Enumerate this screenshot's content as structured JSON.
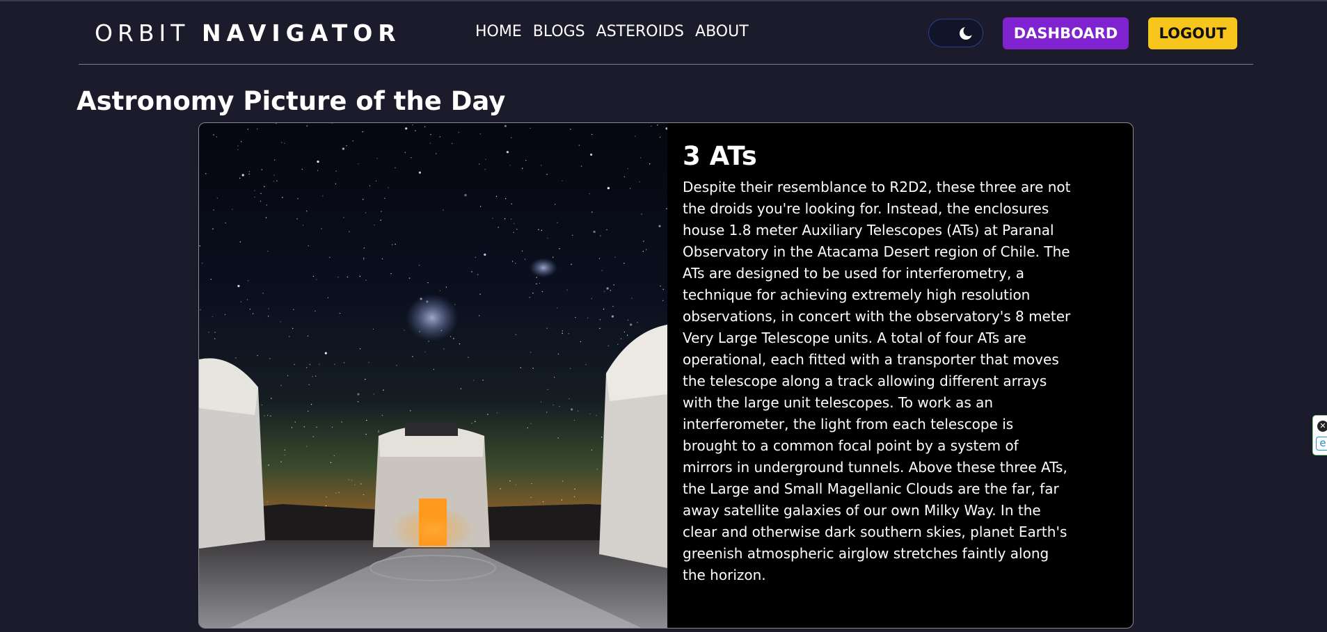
{
  "brand": {
    "light": "ORBIT",
    "bold": "NAVIGATOR"
  },
  "nav": {
    "links": [
      "HOME",
      "BLOGS",
      "ASTEROIDS",
      "ABOUT"
    ],
    "theme_toggle_icon": "moon-icon",
    "dashboard_label": "DASHBOARD",
    "logout_label": "LOGOUT"
  },
  "page": {
    "title": "Astronomy Picture of the Day"
  },
  "apod": {
    "title": "3 ATs",
    "description": "Despite their resemblance to R2D2, these three are not the droids you're looking for. Instead, the enclosures house 1.8 meter Auxiliary Telescopes (ATs) at Paranal Observatory in the Atacama Desert region of Chile. The ATs are designed to be used for interferometry, a technique for achieving extremely high resolution observations, in concert with the observatory's 8 meter Very Large Telescope units. A total of four ATs are operational, each fitted with a transporter that moves the telescope along a track allowing different arrays with the large unit telescopes. To work as an interferometer, the light from each telescope is brought to a common focal point by a system of mirrors in underground tunnels. Above these three ATs, the Large and Small Magellanic Clouds are the far, far away satellite galaxies of our own Milky Way. In the clear and otherwise dark southern skies, planet Earth's greenish atmospheric airglow stretches faintly along the horizon."
  },
  "colors": {
    "background": "#1b1b2b",
    "dashboard_button": "#7f22cf",
    "logout_button": "#f7c51b",
    "card_background": "#000000"
  },
  "extension_widget": {
    "close_glyph": "✕",
    "letter": "e"
  }
}
